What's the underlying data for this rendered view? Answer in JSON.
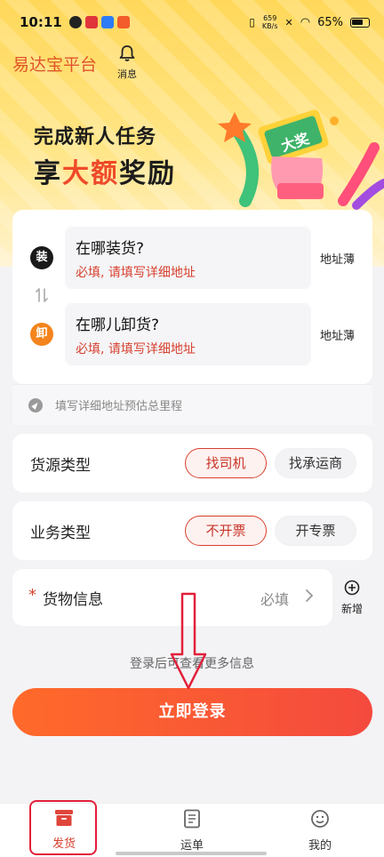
{
  "status_bar": {
    "time": "10:11",
    "speed_value": "659",
    "speed_unit": "KB/s",
    "battery": "65%"
  },
  "header": {
    "brand": "易达宝平台",
    "notification_label": "消息"
  },
  "banner": {
    "line1": "完成新人任务",
    "line2_prefix": "享",
    "line2_highlight": "大额",
    "line2_suffix": "奖励",
    "ticket_text": "大奖"
  },
  "addresses": {
    "load": {
      "badge": "装",
      "title": "在哪装货?",
      "hint": "必填, 请填写详细地址",
      "book": "地址薄"
    },
    "unload": {
      "badge": "卸",
      "title": "在哪儿卸货?",
      "hint": "必填, 请填写详细地址",
      "book": "地址薄"
    },
    "estimate_hint": "填写详细地址预估总里程"
  },
  "cargo_source": {
    "label": "货源类型",
    "options": [
      "找司机",
      "找承运商"
    ],
    "selected": "找司机"
  },
  "business_type": {
    "label": "业务类型",
    "options": [
      "不开票",
      "开专票"
    ],
    "selected": "不开票"
  },
  "goods": {
    "required_mark": "*",
    "label": "货物信息",
    "placeholder": "必填",
    "add_label": "新增"
  },
  "login": {
    "hint": "登录后可查看更多信息",
    "button": "立即登录"
  },
  "tabbar": {
    "items": [
      {
        "label": "发货",
        "icon": "box-icon",
        "active": true
      },
      {
        "label": "运单",
        "icon": "document-icon",
        "active": false
      },
      {
        "label": "我的",
        "icon": "smile-icon",
        "active": false
      }
    ]
  },
  "colors": {
    "accent": "#d7402f",
    "button_start": "#ff6a2a",
    "button_end": "#f44a3e",
    "highlight_box": "#e2203a"
  }
}
